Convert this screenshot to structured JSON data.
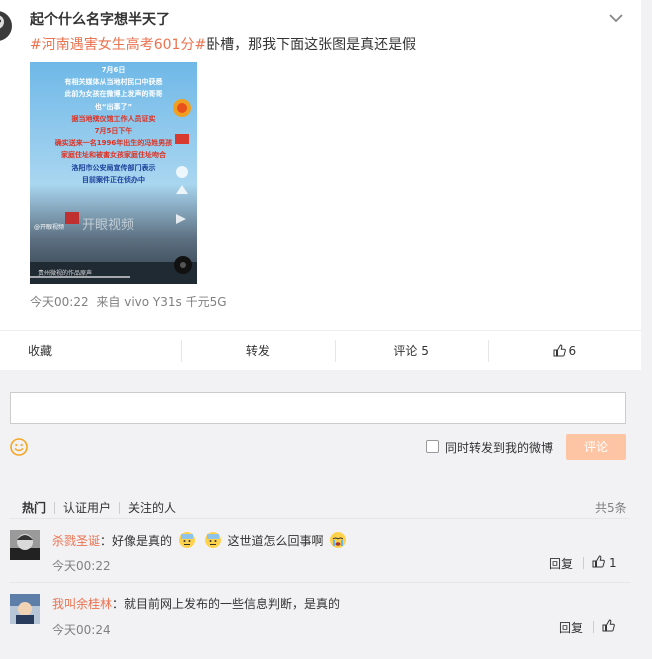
{
  "post": {
    "author": "起个什么名字想半天了",
    "hashtag": "#河南遇害女生高考601分#",
    "text": "卧槽，那我下面这张图是真还是假",
    "time": "今天00:22",
    "source": "来自 vivo Y31s 千元5G",
    "image": {
      "lines": [
        "7月6日",
        "有相关媒体从当地村民口中获悉",
        "此前为女孩在微博上发声的哥哥",
        "也“出事了”",
        "据当地殡仪馆工作人员证实",
        "7月5日下午",
        "确实送来一名1996年出生的冯姓男孩",
        "家庭住址和被害女孩家庭住址吻合",
        "洛阳市公安局宣传部门表示",
        "目前案件正在侦办中"
      ],
      "watermark": "开眼视频",
      "caption": "@开眼视频",
      "footer": "贵州微视的作品原声"
    }
  },
  "actions": {
    "favorite": "收藏",
    "repost": "转发",
    "comment": "评论 5",
    "like_count": "6"
  },
  "composer": {
    "repost_label": "同时转发到我的微博",
    "submit_label": "评论"
  },
  "filters": {
    "hot": "热门",
    "verified": "认证用户",
    "following": "关注的人",
    "total": "共5条"
  },
  "comments": [
    {
      "name": "杀戮圣诞",
      "text_a": "：好像是真的",
      "text_b": "这世道怎么回事啊",
      "time": "今天00:22",
      "reply": "回复",
      "likes": "1"
    },
    {
      "name": "我叫余桂林",
      "text": "：就目前网上发布的一些信息判断，是真的",
      "time": "今天00:24",
      "reply": "回复",
      "likes": ""
    }
  ],
  "colors": {
    "accent": "#eb7350",
    "submit_disabled": "#fec5a5",
    "page_bg": "#f2f2f5"
  }
}
